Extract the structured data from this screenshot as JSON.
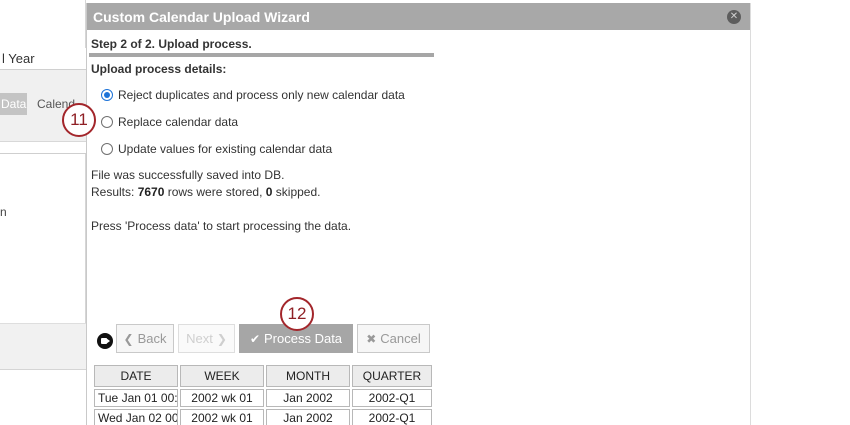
{
  "background": {
    "year_label": "l Year",
    "tab_data": "Data",
    "tab_calendar": "Calend",
    "stray_letter": "n"
  },
  "dialog": {
    "title": "Custom Calendar Upload Wizard",
    "step": "Step 2 of 2. Upload process.",
    "section": "Upload process details:",
    "options": [
      {
        "label": "Reject duplicates and process only new calendar data",
        "checked": true
      },
      {
        "label": "Replace calendar data",
        "checked": false
      },
      {
        "label": "Update values for existing calendar data",
        "checked": false
      }
    ],
    "saved_msg": "File was successfully saved into DB.",
    "results": {
      "prefix": "Results: ",
      "stored": "7670",
      "mid": " rows were stored, ",
      "skipped": "0",
      "suffix": " skipped."
    },
    "hint": "Press 'Process data' to start processing the data."
  },
  "callouts": {
    "first": "11",
    "second": "12"
  },
  "buttons": {
    "back": "Back",
    "next": "Next",
    "process": "Process Data",
    "cancel": "Cancel"
  },
  "icons": {
    "close": "close-icon",
    "back": "chevron-left-icon",
    "next": "chevron-right-icon",
    "process": "checkmark-icon",
    "cancel": "x-icon",
    "video": "video-camera-icon"
  },
  "preview": {
    "columns": [
      "DATE",
      "WEEK",
      "MONTH",
      "QUARTER"
    ],
    "rows": [
      [
        "Tue Jan 01 00:0",
        "2002 wk 01",
        "Jan 2002",
        "2002-Q1"
      ],
      [
        "Wed Jan 02 00:",
        "2002 wk 01",
        "Jan 2002",
        "2002-Q1"
      ]
    ]
  },
  "colors": {
    "header": "#a8a8a8",
    "accent": "#1d73d8",
    "callout": "#a3262b"
  }
}
